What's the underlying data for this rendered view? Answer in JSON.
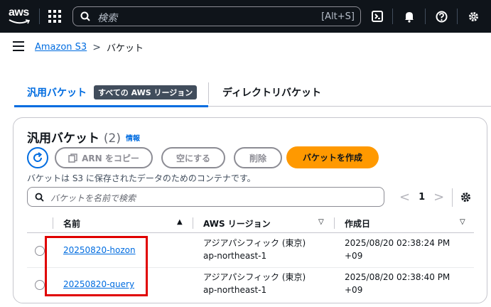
{
  "topbar": {
    "logo_text": "aws",
    "search_placeholder": "検索",
    "search_shortcut": "[Alt+S]",
    "icons": [
      "services-grid-icon",
      "search-icon",
      "cloudshell-icon",
      "bell-icon",
      "help-icon",
      "gear-icon"
    ]
  },
  "breadcrumb": {
    "root": "Amazon S3",
    "separator": ">",
    "current": "バケット"
  },
  "tabs": {
    "general": "汎用バケット",
    "region_badge": "すべての AWS リージョン",
    "directory": "ディレクトリバケット"
  },
  "panel": {
    "title": "汎用バケット",
    "count": "(2)",
    "info": "情報",
    "copy_arn": "ARN をコピー",
    "empty": "空にする",
    "delete": "削除",
    "create": "バケットを作成",
    "description": "バケットは S3 に保存されたデータのためのコンテナです。",
    "filter_placeholder": "バケットを名前で検索",
    "page": "1",
    "prev": "<",
    "next": ">"
  },
  "table": {
    "headers": {
      "name": "名前",
      "region": "AWS リージョン",
      "created": "作成日"
    },
    "rows": [
      {
        "name": "20250820-hozon",
        "region_name": "アジアパシフィック (東京)",
        "region_code": "ap-northeast-1",
        "created_line1": "2025/08/20 02:38:24 PM",
        "created_line2": "+09"
      },
      {
        "name": "20250820-query",
        "region_name": "アジアパシフィック (東京)",
        "region_code": "ap-northeast-1",
        "created_line1": "2025/08/20 02:38:40 PM",
        "created_line2": "+09"
      }
    ]
  },
  "colors": {
    "topbar_bg": "#0f141a",
    "link": "#006ce0",
    "primary_button": "#ff9900",
    "highlight_box": "#e00000"
  }
}
